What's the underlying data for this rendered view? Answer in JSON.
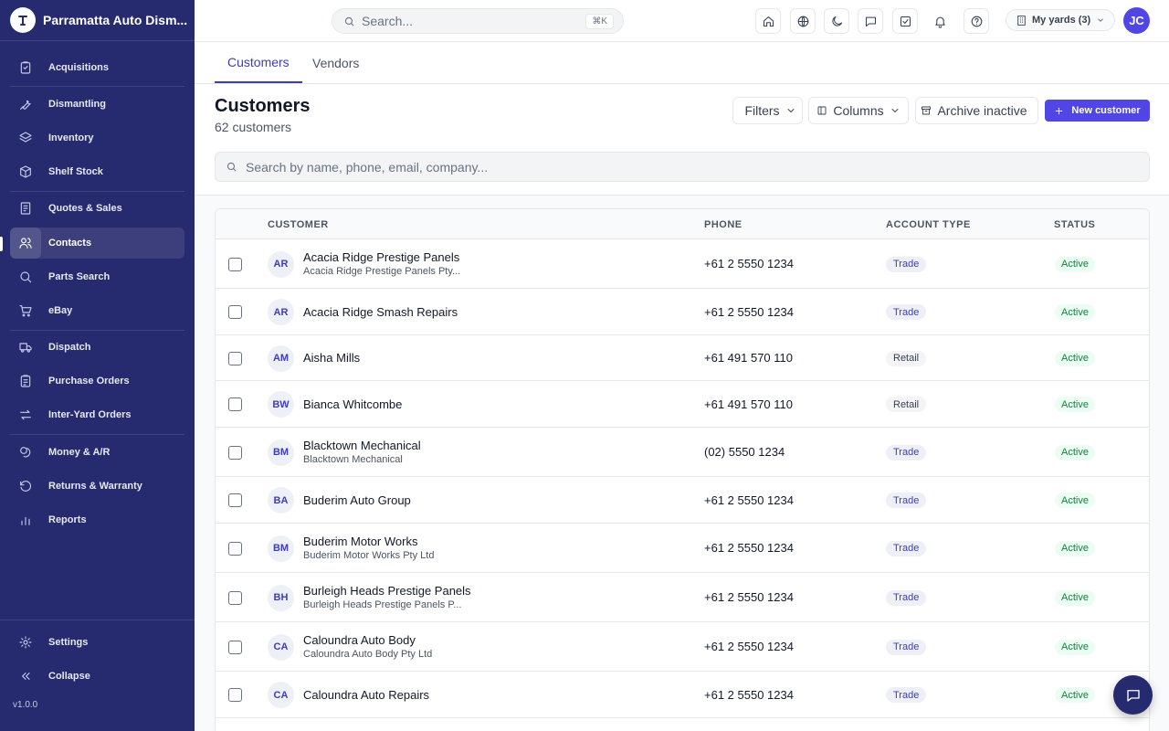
{
  "app": {
    "name": "Parramatta Auto Dism...",
    "version": "v1.0.0"
  },
  "sidebar": {
    "items": [
      {
        "label": "Acquisitions",
        "icon": "clipboard-icon"
      },
      {
        "label": "Dismantling",
        "icon": "wrench-icon"
      },
      {
        "label": "Inventory",
        "icon": "layers-icon"
      },
      {
        "label": "Shelf Stock",
        "icon": "box-icon"
      },
      {
        "label": "Quotes & Sales",
        "icon": "receipt-icon"
      },
      {
        "label": "Contacts",
        "icon": "users-icon"
      },
      {
        "label": "Parts Search",
        "icon": "search-icon"
      },
      {
        "label": "eBay",
        "icon": "cart-icon"
      },
      {
        "label": "Dispatch",
        "icon": "truck-icon"
      },
      {
        "label": "Purchase Orders",
        "icon": "clipboard-list-icon"
      },
      {
        "label": "Inter-Yard Orders",
        "icon": "arrows-swap-icon"
      },
      {
        "label": "Money & A/R",
        "icon": "coins-icon"
      },
      {
        "label": "Returns & Warranty",
        "icon": "rotate-ccw-icon"
      },
      {
        "label": "Reports",
        "icon": "bar-chart-icon"
      }
    ],
    "active": "Contacts",
    "settings_label": "Settings",
    "collapse_label": "Collapse"
  },
  "topbar": {
    "search_placeholder": "Search...",
    "shortcut": "⌘K",
    "yards_label": "My yards (3)",
    "user_initials": "JC"
  },
  "tabs": [
    {
      "label": "Customers",
      "active": true
    },
    {
      "label": "Vendors",
      "active": false
    }
  ],
  "page": {
    "title": "Customers",
    "subtitle": "62 customers",
    "filters_label": "Filters",
    "columns_label": "Columns",
    "archive_label": "Archive inactive",
    "new_label": "New customer",
    "search_placeholder": "Search by name, phone, email, company..."
  },
  "table": {
    "headers": {
      "customer": "CUSTOMER",
      "phone": "PHONE",
      "account_type": "ACCOUNT TYPE",
      "status": "STATUS"
    },
    "rows": [
      {
        "initials": "AR",
        "name": "Acacia Ridge Prestige Panels",
        "company": "Acacia Ridge Prestige Panels Pty...",
        "phone": "+61 2 5550 1234",
        "type": "Trade",
        "status": "Active"
      },
      {
        "initials": "AR",
        "name": "Acacia Ridge Smash Repairs",
        "company": "",
        "phone": "+61 2 5550 1234",
        "type": "Trade",
        "status": "Active"
      },
      {
        "initials": "AM",
        "name": "Aisha Mills",
        "company": "",
        "phone": "+61 491 570 110",
        "type": "Retail",
        "status": "Active"
      },
      {
        "initials": "BW",
        "name": "Bianca Whitcombe",
        "company": "",
        "phone": "+61 491 570 110",
        "type": "Retail",
        "status": "Active"
      },
      {
        "initials": "BM",
        "name": "Blacktown Mechanical",
        "company": "Blacktown Mechanical",
        "phone": "(02) 5550 1234",
        "type": "Trade",
        "status": "Active"
      },
      {
        "initials": "BA",
        "name": "Buderim Auto Group",
        "company": "",
        "phone": "+61 2 5550 1234",
        "type": "Trade",
        "status": "Active"
      },
      {
        "initials": "BM",
        "name": "Buderim Motor Works",
        "company": "Buderim Motor Works Pty Ltd",
        "phone": "+61 2 5550 1234",
        "type": "Trade",
        "status": "Active"
      },
      {
        "initials": "BH",
        "name": "Burleigh Heads Prestige Panels",
        "company": "Burleigh Heads Prestige Panels P...",
        "phone": "+61 2 5550 1234",
        "type": "Trade",
        "status": "Active"
      },
      {
        "initials": "CA",
        "name": "Caloundra Auto Body",
        "company": "Caloundra Auto Body Pty Ltd",
        "phone": "+61 2 5550 1234",
        "type": "Trade",
        "status": "Active"
      },
      {
        "initials": "CA",
        "name": "Caloundra Auto Repairs",
        "company": "",
        "phone": "+61 2 5550 1234",
        "type": "Trade",
        "status": "Active"
      }
    ]
  },
  "colors": {
    "sidebar_bg": "#262a6e",
    "accent": "#4f46e5",
    "active_tab": "#3f3cbb",
    "status_active": "#15803d"
  }
}
